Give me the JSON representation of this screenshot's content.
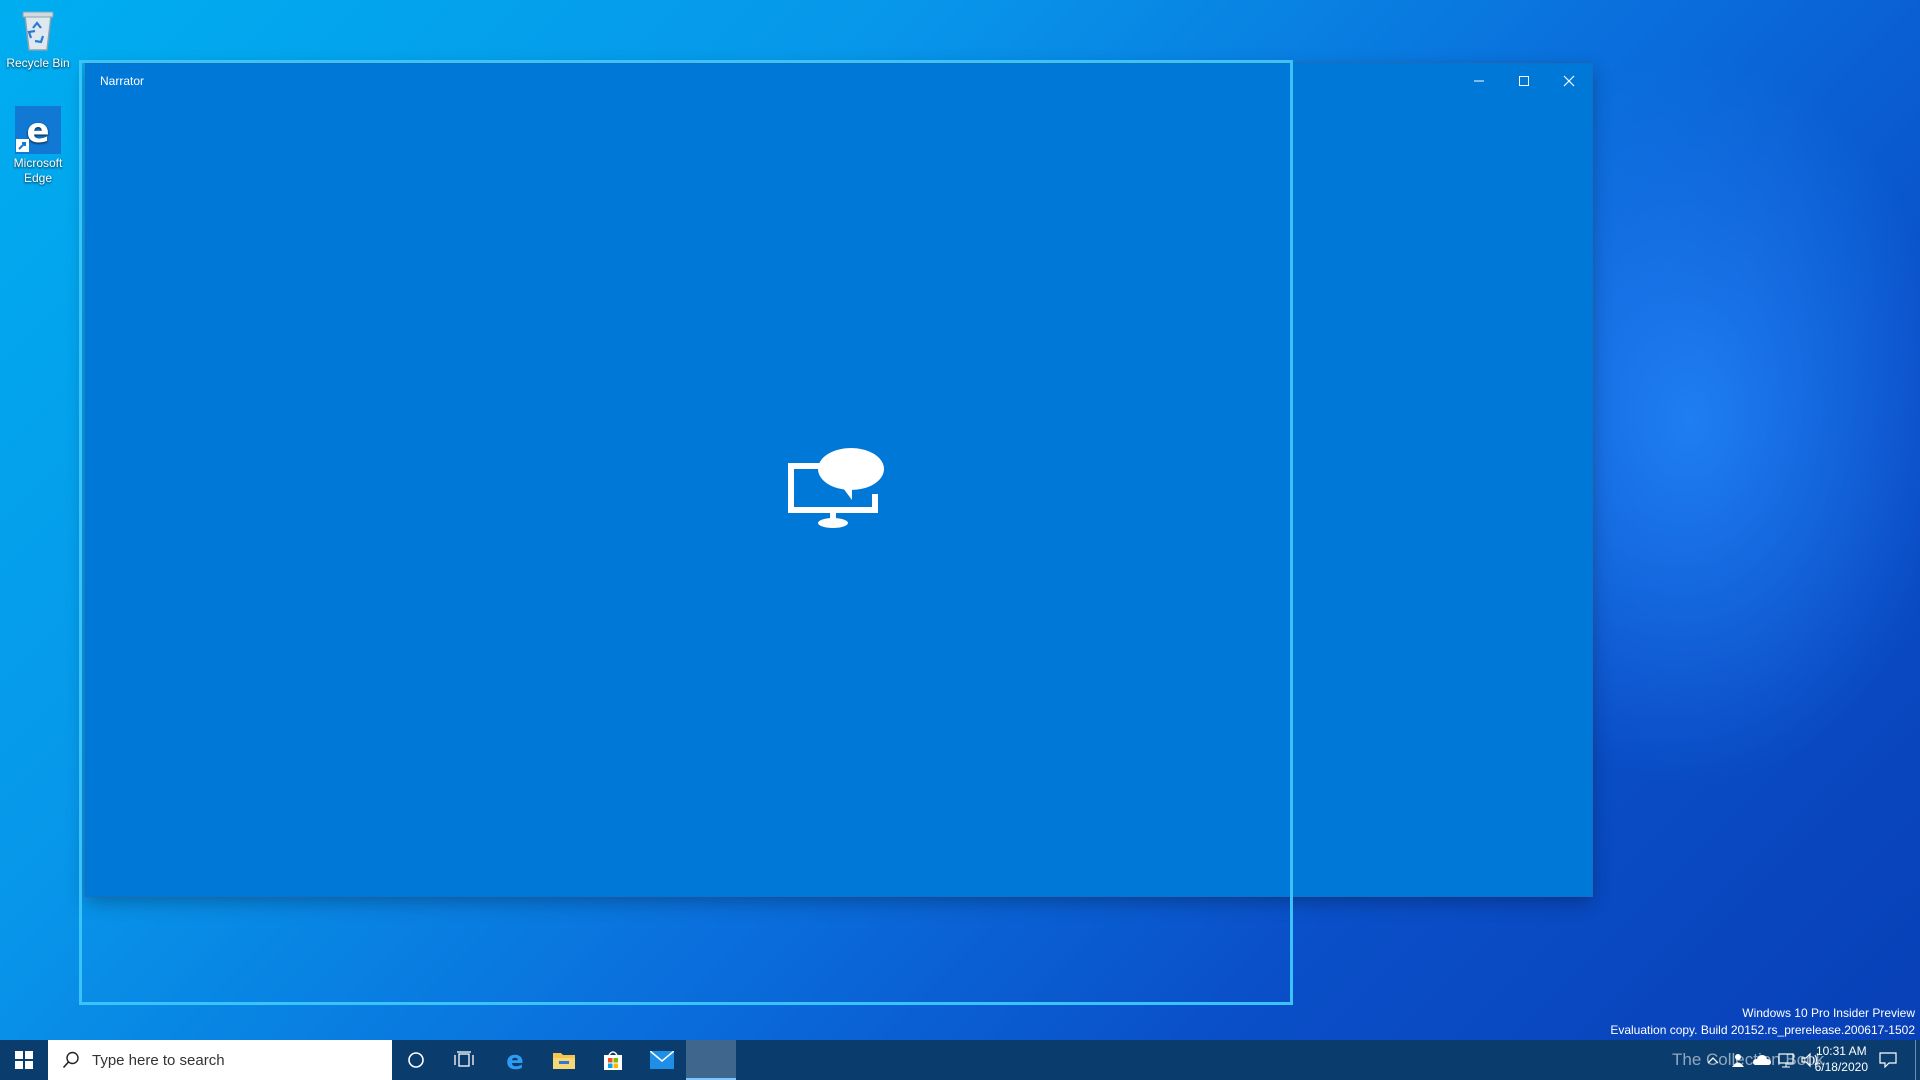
{
  "desktop": {
    "icons": [
      {
        "label": "Recycle Bin"
      },
      {
        "label": "Microsoft Edge"
      }
    ]
  },
  "window": {
    "title": "Narrator",
    "background": "#0078d7"
  },
  "watermark": {
    "line1": "Windows 10 Pro Insider Preview",
    "line2": "Evaluation copy. Build 20152.rs_prerelease.200617-1502"
  },
  "taskbar": {
    "search": {
      "placeholder": "Type here to search"
    },
    "pinned": [
      "start-icon",
      "cortana-icon",
      "task-view-icon",
      "edge-icon",
      "file-explorer-icon",
      "store-icon",
      "mail-icon",
      "narrator-icon"
    ]
  },
  "tray": {
    "time": "10:31 AM",
    "date": "6/18/2020",
    "overlay_text": "The Collection Book"
  },
  "colors": {
    "accent": "#0078d7",
    "taskbar": "#0a3c6e",
    "focus_rect": "#3ac3f8"
  }
}
